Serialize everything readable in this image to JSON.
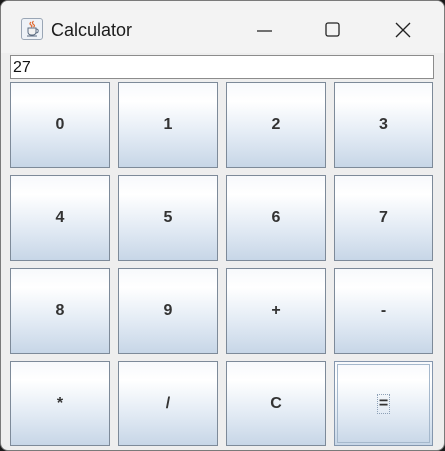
{
  "window": {
    "title": "Calculator",
    "icon": "java-cup-icon",
    "controls": [
      "minimize-icon",
      "maximize-icon",
      "close-icon"
    ]
  },
  "display": {
    "value": "27"
  },
  "keypad": {
    "rows": [
      [
        "0",
        "1",
        "2",
        "3"
      ],
      [
        "4",
        "5",
        "6",
        "7"
      ],
      [
        "8",
        "9",
        "+",
        "-"
      ],
      [
        "*",
        "/",
        "C",
        "="
      ]
    ],
    "focused": "="
  },
  "colors": {
    "button_top": "#ffffff",
    "button_bottom": "#c7d6e7",
    "button_border": "#7d8a99",
    "label": "#333333"
  }
}
